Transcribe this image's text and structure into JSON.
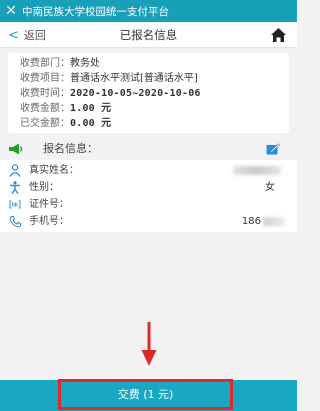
{
  "titlebar": {
    "close_icon": "close-icon",
    "title": "中南民族大学校园统一支付平台"
  },
  "navbar": {
    "back_label": "返回",
    "page_title": "已报名信息",
    "home_icon": "home-icon"
  },
  "fee_info": {
    "dept_label": "收费部门：",
    "dept_value": "教务处",
    "item_label": "收费项目：",
    "item_value": "普通话水平测试[普通话水平]",
    "time_label": "收费时间：",
    "time_value": "2020-10-05~2020-10-06",
    "amount_label": "收费金额：",
    "amount_value": "1.00 元",
    "paid_label": "已交金额：",
    "paid_value": "0.00 元"
  },
  "registration": {
    "header_label": "报名信息：",
    "name_label": "真实姓名：",
    "name_value": "",
    "gender_label": "性别：",
    "gender_value": "女",
    "id_label": "证件号：",
    "id_value": "",
    "phone_label": "手机号：",
    "phone_value": "186"
  },
  "pay_button": {
    "label": "交费 (1 元)"
  },
  "colors": {
    "brand": "#19a8c4",
    "accent": "#1aa0c8",
    "highlight": "#e02a2a"
  }
}
